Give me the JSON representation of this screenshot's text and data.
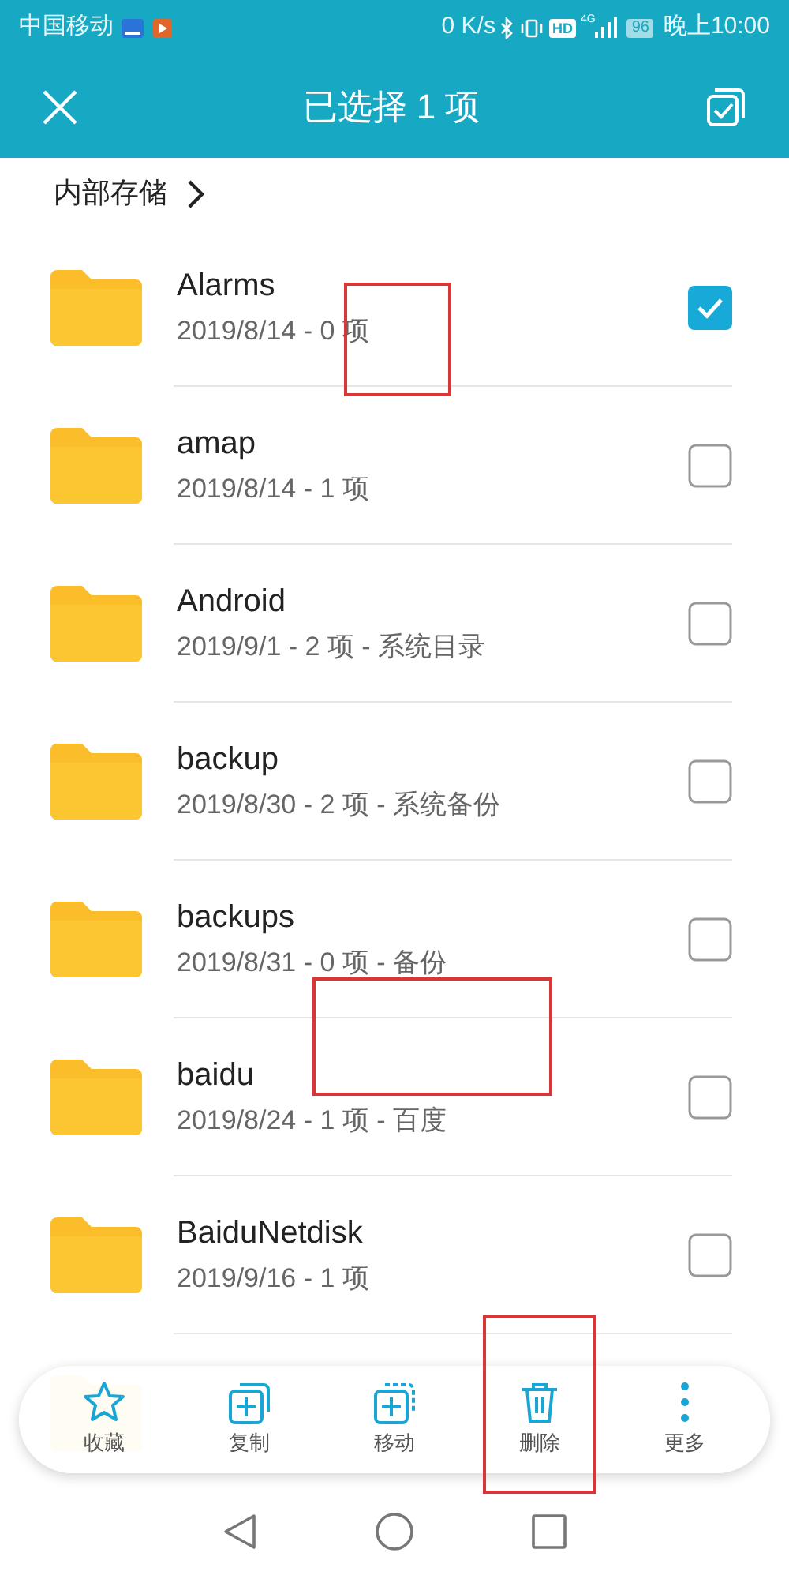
{
  "status_bar": {
    "carrier": "中国移动",
    "speed": "0 K/s",
    "hd": "HD",
    "network": "4G",
    "battery": "96",
    "time": "晚上10:00"
  },
  "header": {
    "title": "已选择 1 项"
  },
  "breadcrumb": {
    "label": "内部存储"
  },
  "files": [
    {
      "name": "Alarms",
      "details": "2019/8/14 - 0 项",
      "selected": true,
      "annotated": true
    },
    {
      "name": "amap",
      "details": "2019/8/14 - 1 项",
      "selected": false,
      "annotated": false
    },
    {
      "name": "Android",
      "details": "2019/9/1 - 2 项 - 系统目录",
      "selected": false,
      "annotated": false
    },
    {
      "name": "backup",
      "details": "2019/8/30 - 2 项 - 系统备份",
      "selected": false,
      "annotated": false
    },
    {
      "name": "backups",
      "details": "2019/8/31 - 0 项 - 备份",
      "selected": false,
      "annotated": true
    },
    {
      "name": "baidu",
      "details": "2019/8/24 - 1 项 - 百度",
      "selected": false,
      "annotated": false
    },
    {
      "name": "BaiduNetdisk",
      "details": "2019/9/16 - 1 项",
      "selected": false,
      "annotated": false
    },
    {
      "annotated": false
    }
  ],
  "toolbar": [
    {
      "kind": "star",
      "label": "收藏",
      "annotated": false
    },
    {
      "kind": "copy",
      "label": "复制",
      "annotated": false
    },
    {
      "kind": "move",
      "label": "移动",
      "annotated": false
    },
    {
      "kind": "delete",
      "label": "删除",
      "annotated": true
    },
    {
      "kind": "more",
      "label": "更多",
      "annotated": false
    }
  ]
}
